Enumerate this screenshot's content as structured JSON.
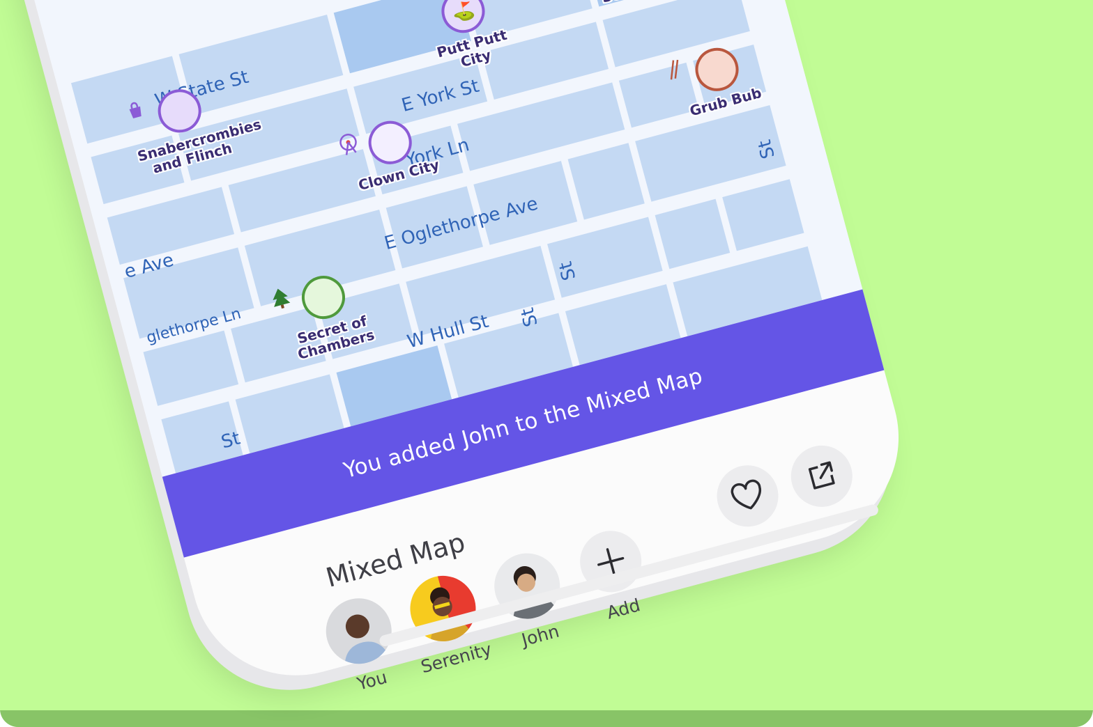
{
  "map": {
    "streets": [
      "W State St",
      "E York St",
      "York Ln",
      "e Ave",
      "E Oglethorpe Ave",
      "glethorpe Ln",
      "W Hull St",
      "St",
      "St",
      "St",
      "St"
    ],
    "pois": [
      {
        "name": "Snabercrombies and Flinch",
        "icon": "shopping-bag-icon",
        "color": "#8b5bd6"
      },
      {
        "name": "Putt Putt City",
        "icon": "golf-icon",
        "color": "#8b5bd6"
      },
      {
        "name": "SOS",
        "icon": "sos-icon",
        "color": "#e04747"
      },
      {
        "name": "Clown City",
        "icon": "ferris-wheel-icon",
        "color": "#8b5bd6"
      },
      {
        "name": "Grub Bub",
        "icon": "chopsticks-icon",
        "color": "#b9573e"
      },
      {
        "name": "Secret of Chambers",
        "icon": "tree-icon",
        "color": "#4f9a3c"
      }
    ]
  },
  "toast": {
    "message": "You added John to the Mixed Map"
  },
  "sheet": {
    "title": "Mixed Map",
    "members": [
      {
        "name": "You",
        "avatar": "avatar-you"
      },
      {
        "name": "Serenity",
        "avatar": "avatar-serenity"
      },
      {
        "name": "John",
        "avatar": "avatar-john"
      }
    ],
    "add_label": "Add",
    "actions": [
      {
        "icon": "heart-icon"
      },
      {
        "icon": "share-icon"
      }
    ]
  },
  "colors": {
    "background": "#c1fc95",
    "ground": "#88c467",
    "toast": "#6455e6",
    "map_block": "#c4d9f3"
  }
}
